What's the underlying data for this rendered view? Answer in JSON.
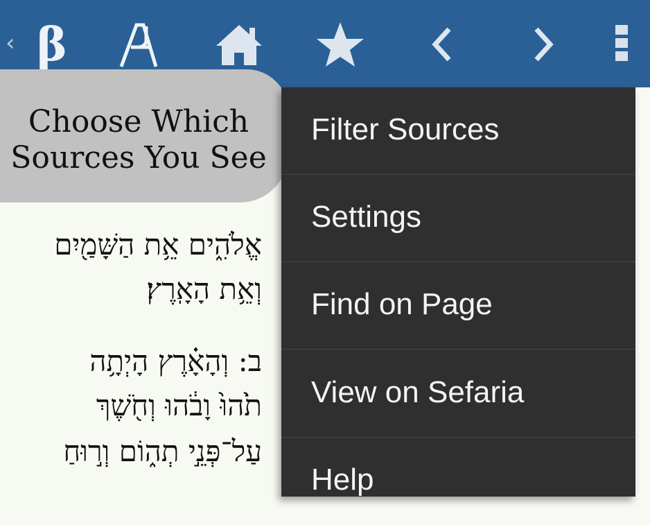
{
  "toolbar": {
    "back_icon": "chevron-left-small",
    "logo_glyph": "β",
    "alef_glyph": "A",
    "home_icon": "home-icon",
    "star_icon": "star-icon",
    "prev_icon": "chevron-left-icon",
    "next_icon": "chevron-right-icon",
    "overflow_icon": "overflow-menu-icon",
    "colors": {
      "bar": "#2a6096",
      "icon": "#dde6ef"
    }
  },
  "reader": {
    "lines": [
      "אֱלֹהִ֑ים אֵ֥ת הַשָּׁמַ֖יִם",
      "וְאֵ֥ת הָאָֽרֶץ׃",
      "ב: וְהָאָ֗רֶץ הָיְתָ֥ה",
      "תֹ֙הוּ֙ וָבֹ֔הוּ וְחֹ֖שֶׁךְ",
      "עַל־פְּנֵ֣י תְה֑וֹם וְר֣וּחַ"
    ]
  },
  "tooltip": {
    "line1": "Choose Which",
    "line2": "Sources You See",
    "color": "#c1c1c1"
  },
  "menu": {
    "items": [
      {
        "label": "Filter Sources"
      },
      {
        "label": "Settings"
      },
      {
        "label": "Find on Page"
      },
      {
        "label": "View on Sefaria"
      },
      {
        "label": "Help"
      }
    ],
    "colors": {
      "background": "#2f2f2f",
      "text": "#f4f4f4"
    }
  }
}
